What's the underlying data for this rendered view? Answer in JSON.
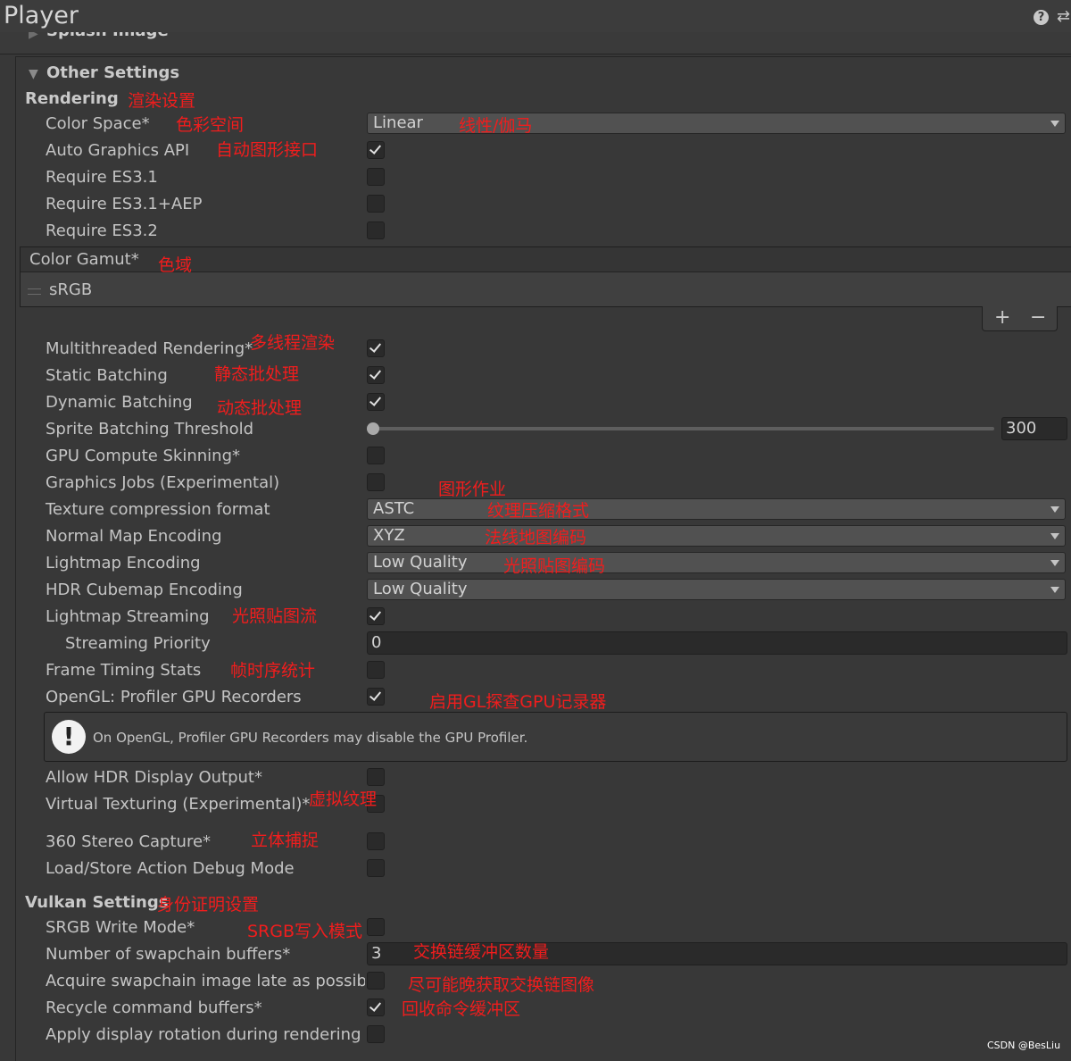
{
  "window": {
    "title": "Player",
    "help_icon": "question-icon",
    "preset_icon": "sliders-icon"
  },
  "splash": {
    "label": "Splash Image"
  },
  "other_settings": {
    "title": "Other Settings"
  },
  "rendering": {
    "title": "Rendering",
    "title_ann": "渲染设置",
    "color_space": {
      "label": "Color Space*",
      "ann": "色彩空间",
      "value": "Linear",
      "value_ann": "线性/伽马"
    },
    "auto_graphics_api": {
      "label": "Auto Graphics API",
      "ann": "自动图形接口",
      "checked": true
    },
    "require_es31": {
      "label": "Require ES3.1",
      "checked": false
    },
    "require_es31_aep": {
      "label": "Require ES3.1+AEP",
      "checked": false
    },
    "require_es32": {
      "label": "Require ES3.2",
      "checked": false
    },
    "color_gamut": {
      "label": "Color Gamut*",
      "ann": "色域",
      "items": [
        "sRGB"
      ],
      "add_label": "+",
      "remove_label": "−"
    },
    "multithreaded": {
      "label": "Multithreaded Rendering*",
      "ann": "多线程渲染",
      "checked": true
    },
    "static_batching": {
      "label": "Static Batching",
      "ann": "静态批处理",
      "checked": true
    },
    "dynamic_batching": {
      "label": "Dynamic Batching",
      "ann": "动态批处理",
      "checked": true
    },
    "sprite_threshold": {
      "label": "Sprite Batching Threshold",
      "value": "300",
      "slider_fraction": 0.0
    },
    "gpu_skinning": {
      "label": "GPU Compute Skinning*",
      "checked": false
    },
    "graphics_jobs": {
      "label": "Graphics Jobs (Experimental)",
      "ann": "图形作业",
      "checked": false
    },
    "texture_compression": {
      "label": "Texture compression format",
      "value": "ASTC",
      "value_ann": "纹理压缩格式"
    },
    "normal_map": {
      "label": "Normal Map Encoding",
      "value": "XYZ",
      "value_ann": "法线地图编码"
    },
    "lightmap_encoding": {
      "label": "Lightmap Encoding",
      "value": "Low Quality",
      "value_ann": "光照贴图编码"
    },
    "hdr_cubemap": {
      "label": "HDR Cubemap Encoding",
      "value": "Low Quality"
    },
    "lightmap_streaming": {
      "label": "Lightmap Streaming",
      "ann": "光照贴图流",
      "checked": true
    },
    "streaming_priority": {
      "label": "Streaming Priority",
      "value": "0"
    },
    "frame_timing": {
      "label": "Frame Timing Stats",
      "ann": "帧时序统计",
      "checked": false
    },
    "opengl_profiler": {
      "label": "OpenGL: Profiler GPU Recorders",
      "ann": "启用GL探查GPU记录器",
      "checked": true
    },
    "opengl_help": "On OpenGL, Profiler GPU Recorders may disable the GPU Profiler.",
    "hdr_display": {
      "label": "Allow HDR Display Output*",
      "checked": false
    },
    "virtual_texturing": {
      "label": "Virtual Texturing (Experimental)*",
      "ann": "虚拟纹理",
      "checked": false
    },
    "stereo_capture": {
      "label": "360 Stereo Capture*",
      "ann": "立体捕捉",
      "checked": false
    },
    "load_store": {
      "label": "Load/Store Action Debug Mode",
      "checked": false
    }
  },
  "vulkan": {
    "title": "Vulkan Settings",
    "title_ann": "身份证明设置",
    "srgb_write": {
      "label": "SRGB Write Mode*",
      "ann": "SRGB写入模式",
      "checked": false
    },
    "swapchain_buffers": {
      "label": "Number of swapchain buffers*",
      "ann": "交换链缓冲区数量",
      "value": "3"
    },
    "acquire_late": {
      "label": "Acquire swapchain image late as possible",
      "ann": "尽可能晚获取交换链图像",
      "checked": false
    },
    "recycle_buffers": {
      "label": "Recycle command buffers*",
      "ann": "回收命令缓冲区",
      "checked": true
    },
    "display_rotation": {
      "label": "Apply display rotation during rendering",
      "checked": false
    }
  },
  "watermark": "CSDN @BesLiu"
}
